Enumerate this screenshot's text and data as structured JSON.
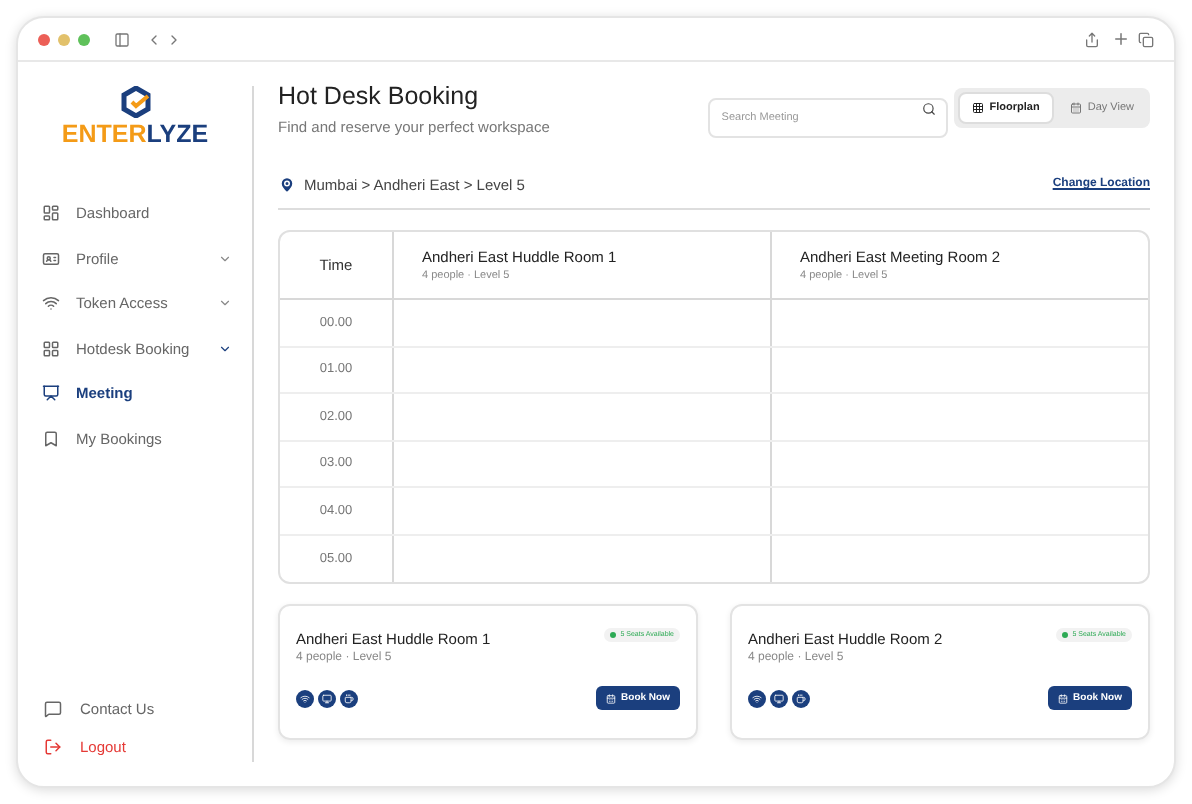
{
  "logo": {
    "text_a": "ENTER",
    "text_b": "LYZE"
  },
  "sidebar": {
    "items": [
      {
        "kind": "dashboard",
        "label": "Dashboard",
        "selected": false
      },
      {
        "kind": "profile",
        "label": "Profile",
        "selected": false,
        "expandable": true
      },
      {
        "kind": "token",
        "label": "Token Access",
        "selected": false,
        "expandable": true
      },
      {
        "kind": "hotdesk",
        "label": "Hotdesk Booking",
        "selected": false,
        "expandable": true
      },
      {
        "kind": "meeting",
        "label": "Meeting",
        "selected": true
      },
      {
        "kind": "bookings",
        "label": "My Bookings",
        "selected": false
      }
    ],
    "bottom": [
      {
        "kind": "contact",
        "label": "Contact Us"
      },
      {
        "kind": "logout",
        "label": "Logout"
      }
    ]
  },
  "header": {
    "title": "Hot Desk Booking",
    "subtitle": "Find and reserve your perfect workspace"
  },
  "search": {
    "placeholder": "Search Meeting"
  },
  "view_toggle": [
    {
      "kind": "floorplan",
      "label": "Floorplan",
      "selected": true
    },
    {
      "kind": "day",
      "label": "Day View",
      "selected": false
    }
  ],
  "breadcrumb": "Mumbai > Andheri East > Level 5",
  "change_location": "Change Location",
  "schedule": {
    "time_header": "Time",
    "rooms": [
      {
        "name": "Andheri East Huddle Room 1",
        "info": "4 people · Level 5"
      },
      {
        "name": "Andheri East Meeting Room 2",
        "info": "4 people · Level 5"
      }
    ],
    "times": [
      "00.00",
      "01.00",
      "02.00",
      "03.00",
      "04.00",
      "05.00"
    ]
  },
  "room_cards": [
    {
      "name": "Andheri East Huddle Room 1",
      "info": "4 people · Level 5",
      "availability": "5 Seats Available",
      "button": "Book Now"
    },
    {
      "name": "Andheri East Huddle Room 2",
      "info": "4 people · Level 5",
      "availability": "5 Seats Available",
      "button": "Book Now"
    }
  ]
}
